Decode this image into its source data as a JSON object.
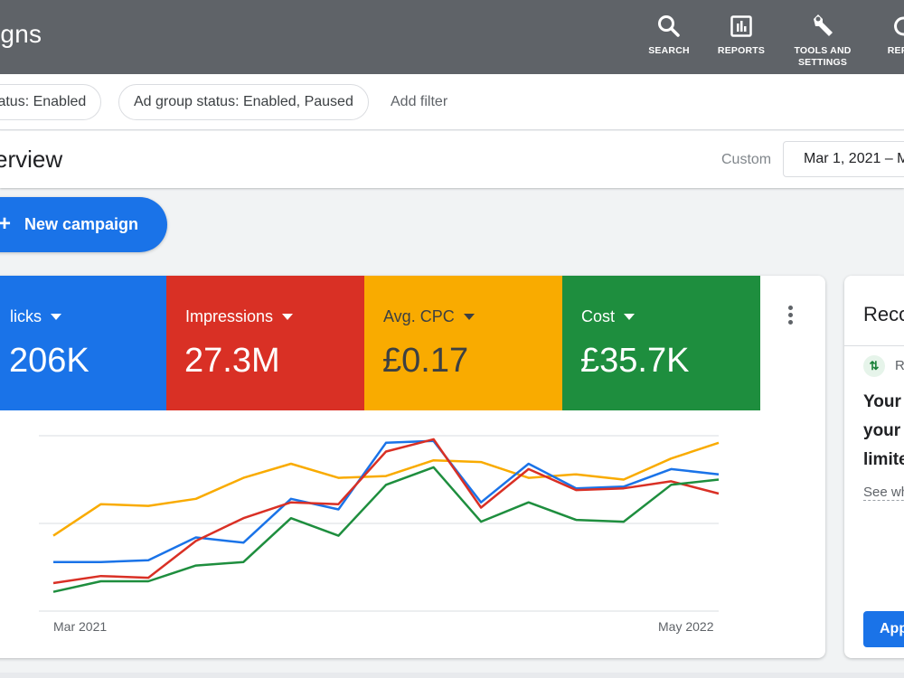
{
  "header": {
    "title": "igns",
    "buttons": [
      {
        "label": "SEARCH",
        "icon": "search-icon"
      },
      {
        "label": "REPORTS",
        "icon": "reports-icon"
      },
      {
        "label": "TOOLS AND SETTINGS",
        "icon": "wrench-icon"
      },
      {
        "label": "REFRE",
        "icon": "refresh-icon"
      }
    ]
  },
  "filters": {
    "chips": [
      "tatus: Enabled",
      "Ad group status: Enabled, Paused"
    ],
    "add_filter": "Add filter"
  },
  "overview": {
    "title": "erview",
    "custom_label": "Custom",
    "date_range": "Mar 1, 2021 – M"
  },
  "new_campaign": {
    "plus": "+",
    "label": "New campaign"
  },
  "metrics": [
    {
      "label": "licks",
      "value": "206K",
      "color": "#1a73e8",
      "text_color": "#ffffff"
    },
    {
      "label": "Impressions",
      "value": "27.3M",
      "color": "#d93025",
      "text_color": "#ffffff"
    },
    {
      "label": "Avg. CPC",
      "value": "£0.17",
      "color": "#f9ab00",
      "text_color": "#3c4043"
    },
    {
      "label": "Cost",
      "value": "£35.7K",
      "color": "#1e8e3e",
      "text_color": "#ffffff"
    }
  ],
  "chart_data": {
    "type": "line",
    "x_start_label": "Mar 2021",
    "x_end_label": "May 2022",
    "series": [
      {
        "color": "#f9ab00",
        "values": [
          43,
          61,
          60,
          64,
          76,
          84,
          76,
          77,
          86,
          85,
          76,
          78,
          75,
          87,
          96
        ]
      },
      {
        "color": "#1a73e8",
        "values": [
          28,
          28,
          29,
          42,
          39,
          64,
          58,
          96,
          97,
          62,
          84,
          70,
          71,
          81,
          78
        ]
      },
      {
        "color": "#d93025",
        "values": [
          16,
          20,
          19,
          40,
          53,
          62,
          61,
          91,
          98,
          59,
          81,
          69,
          70,
          74,
          67
        ]
      },
      {
        "color": "#1e8e3e",
        "values": [
          11,
          17,
          17,
          26,
          28,
          53,
          43,
          72,
          82,
          51,
          62,
          52,
          51,
          72,
          75
        ]
      }
    ]
  },
  "recommendations": {
    "title": "Reco",
    "item_r": "R",
    "headline": [
      "Your",
      "your l",
      "limite"
    ],
    "see": "See wh",
    "apply": "App"
  }
}
